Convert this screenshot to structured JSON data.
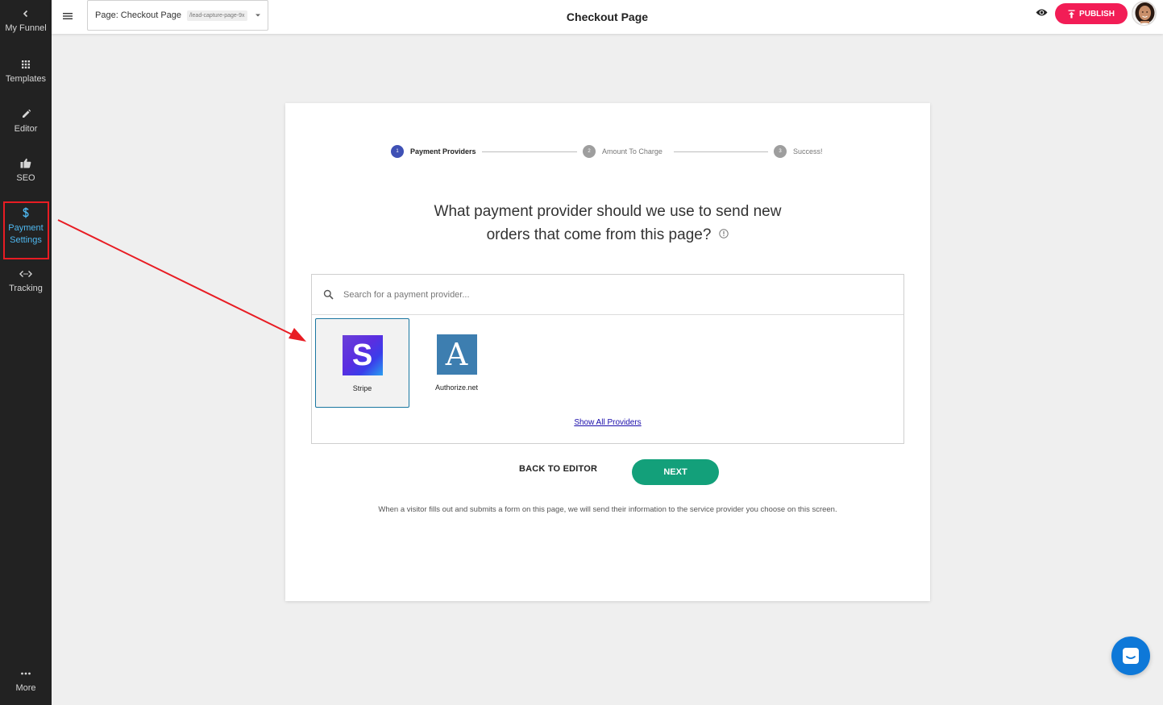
{
  "sidebar": {
    "items": [
      {
        "label": "My Funnel",
        "icon": "chevron-left-icon"
      },
      {
        "label": "Templates",
        "icon": "grid-icon"
      },
      {
        "label": "Editor",
        "icon": "pencil-icon"
      },
      {
        "label": "SEO",
        "icon": "thumbs-up-icon"
      },
      {
        "label_line1": "Payment",
        "label_line2": "Settings",
        "icon": "dollar-icon",
        "active": true
      },
      {
        "label": "Tracking",
        "icon": "code-icon"
      },
      {
        "label": "More",
        "icon": "more-dots-icon"
      }
    ]
  },
  "topbar": {
    "page_label": "Page: Checkout Page",
    "page_slug": "/lead-capture-page-9x",
    "title": "Checkout Page",
    "publish_label": "PUBLISH"
  },
  "stepper": {
    "steps": [
      {
        "number": "1",
        "label": "Payment Providers",
        "state": "active"
      },
      {
        "number": "2",
        "label": "Amount To Charge",
        "state": "inactive"
      },
      {
        "number": "3",
        "label": "Success!",
        "state": "inactive"
      }
    ]
  },
  "question": {
    "line1": "What payment provider should we use to send new",
    "line2": "orders that come from this page?"
  },
  "providers": {
    "search_placeholder": "Search for a payment provider...",
    "items": [
      {
        "name": "Stripe",
        "logo_letter": "S",
        "selected": true
      },
      {
        "name": "Authorize.net",
        "logo_letter": "A",
        "selected": false
      }
    ],
    "show_all_label": "Show All Providers"
  },
  "actions": {
    "back_label": "BACK TO EDITOR",
    "next_label": "NEXT"
  },
  "footnote": "When a visitor fills out and submits a form on this page, we will send their information to the service provider you choose on this screen.",
  "colors": {
    "sidebar_bg": "#222222",
    "accent_active": "#4fb8f0",
    "publish": "#f21d56",
    "next": "#13a07a",
    "step_active": "#3f51b5",
    "annotation_red": "#e81c23",
    "chat": "#0e78d8"
  }
}
